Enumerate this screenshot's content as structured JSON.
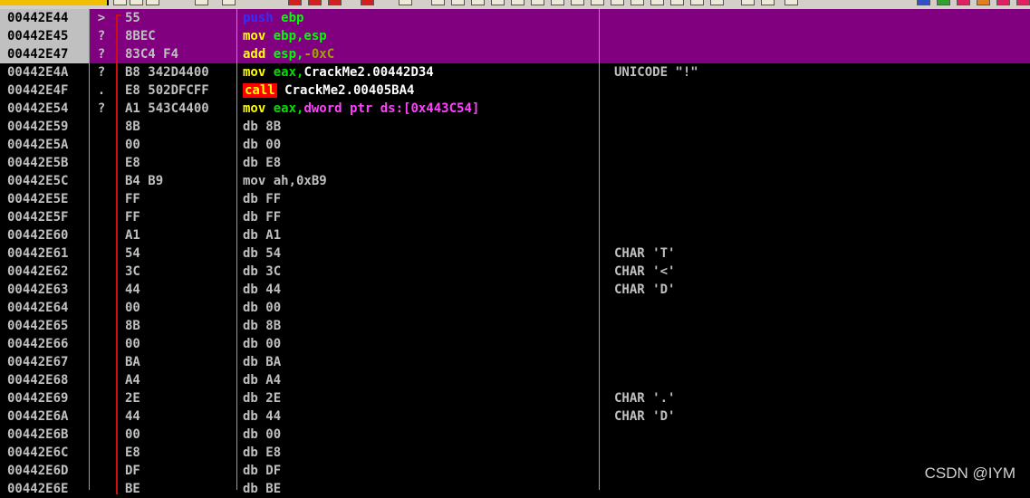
{
  "rows": [
    {
      "addr": "00442E44",
      "mark": ">",
      "hex": "55",
      "asm": [
        {
          "t": "push",
          "c": "c-blue"
        },
        {
          "t": " ebp",
          "c": "c-lime"
        }
      ],
      "cmt": ""
    },
    {
      "addr": "00442E45",
      "mark": "?",
      "hex": "8BEC",
      "asm": [
        {
          "t": "mov ",
          "c": "c-yellow"
        },
        {
          "t": "ebp,esp",
          "c": "c-lime"
        }
      ],
      "cmt": ""
    },
    {
      "addr": "00442E47",
      "mark": "?",
      "hex": "83C4 F4",
      "asm": [
        {
          "t": "add ",
          "c": "c-yellow"
        },
        {
          "t": "esp,",
          "c": "c-lime"
        },
        {
          "t": "-0xC",
          "c": "c-olive"
        }
      ],
      "cmt": ""
    },
    {
      "addr": "00442E4A",
      "mark": "?",
      "hex": "B8 342D4400",
      "asm": [
        {
          "t": "mov ",
          "c": "c-yellow"
        },
        {
          "t": "eax,",
          "c": "c-green"
        },
        {
          "t": "CrackMe2.00442D34",
          "c": "c-white"
        }
      ],
      "cmt": "UNICODE \"!\""
    },
    {
      "addr": "00442E4F",
      "mark": ".",
      "hex": "E8 502DFCFF",
      "asm": [
        {
          "t": "call",
          "c": "call"
        },
        {
          "t": " CrackMe2.00405BA4",
          "c": "c-white"
        }
      ],
      "cmt": ""
    },
    {
      "addr": "00442E54",
      "mark": "?",
      "hex": "A1 543C4400",
      "asm": [
        {
          "t": "mov ",
          "c": "c-yellow"
        },
        {
          "t": "eax,",
          "c": "c-green"
        },
        {
          "t": "dword ptr ds:[0x443C54]",
          "c": "c-magenta"
        }
      ],
      "cmt": ""
    },
    {
      "addr": "00442E59",
      "mark": "",
      "hex": "8B",
      "asm": [
        {
          "t": "db 8B",
          "c": "c-gray"
        }
      ],
      "cmt": ""
    },
    {
      "addr": "00442E5A",
      "mark": "",
      "hex": "00",
      "asm": [
        {
          "t": "db 00",
          "c": "c-gray"
        }
      ],
      "cmt": ""
    },
    {
      "addr": "00442E5B",
      "mark": "",
      "hex": "E8",
      "asm": [
        {
          "t": "db E8",
          "c": "c-gray"
        }
      ],
      "cmt": ""
    },
    {
      "addr": "00442E5C",
      "mark": "",
      "hex": "B4 B9",
      "asm": [
        {
          "t": "mov ah,0xB9",
          "c": "c-gray"
        }
      ],
      "cmt": ""
    },
    {
      "addr": "00442E5E",
      "mark": "",
      "hex": "FF",
      "asm": [
        {
          "t": "db FF",
          "c": "c-gray"
        }
      ],
      "cmt": ""
    },
    {
      "addr": "00442E5F",
      "mark": "",
      "hex": "FF",
      "asm": [
        {
          "t": "db FF",
          "c": "c-gray"
        }
      ],
      "cmt": ""
    },
    {
      "addr": "00442E60",
      "mark": "",
      "hex": "A1",
      "asm": [
        {
          "t": "db A1",
          "c": "c-gray"
        }
      ],
      "cmt": ""
    },
    {
      "addr": "00442E61",
      "mark": "",
      "hex": "54",
      "asm": [
        {
          "t": "db 54",
          "c": "c-gray"
        }
      ],
      "cmt": "CHAR 'T'"
    },
    {
      "addr": "00442E62",
      "mark": "",
      "hex": "3C",
      "asm": [
        {
          "t": "db 3C",
          "c": "c-gray"
        }
      ],
      "cmt": "CHAR '<'"
    },
    {
      "addr": "00442E63",
      "mark": "",
      "hex": "44",
      "asm": [
        {
          "t": "db 44",
          "c": "c-gray"
        }
      ],
      "cmt": "CHAR 'D'"
    },
    {
      "addr": "00442E64",
      "mark": "",
      "hex": "00",
      "asm": [
        {
          "t": "db 00",
          "c": "c-gray"
        }
      ],
      "cmt": ""
    },
    {
      "addr": "00442E65",
      "mark": "",
      "hex": "8B",
      "asm": [
        {
          "t": "db 8B",
          "c": "c-gray"
        }
      ],
      "cmt": ""
    },
    {
      "addr": "00442E66",
      "mark": "",
      "hex": "00",
      "asm": [
        {
          "t": "db 00",
          "c": "c-gray"
        }
      ],
      "cmt": ""
    },
    {
      "addr": "00442E67",
      "mark": "",
      "hex": "BA",
      "asm": [
        {
          "t": "db BA",
          "c": "c-gray"
        }
      ],
      "cmt": ""
    },
    {
      "addr": "00442E68",
      "mark": "",
      "hex": "A4",
      "asm": [
        {
          "t": "db A4",
          "c": "c-gray"
        }
      ],
      "cmt": ""
    },
    {
      "addr": "00442E69",
      "mark": "",
      "hex": "2E",
      "asm": [
        {
          "t": "db 2E",
          "c": "c-gray"
        }
      ],
      "cmt": "CHAR '.'"
    },
    {
      "addr": "00442E6A",
      "mark": "",
      "hex": "44",
      "asm": [
        {
          "t": "db 44",
          "c": "c-gray"
        }
      ],
      "cmt": "CHAR 'D'"
    },
    {
      "addr": "00442E6B",
      "mark": "",
      "hex": "00",
      "asm": [
        {
          "t": "db 00",
          "c": "c-gray"
        }
      ],
      "cmt": ""
    },
    {
      "addr": "00442E6C",
      "mark": "",
      "hex": "E8",
      "asm": [
        {
          "t": "db E8",
          "c": "c-gray"
        }
      ],
      "cmt": ""
    },
    {
      "addr": "00442E6D",
      "mark": "",
      "hex": "DF",
      "asm": [
        {
          "t": "db DF",
          "c": "c-gray"
        }
      ],
      "cmt": ""
    },
    {
      "addr": "00442E6E",
      "mark": "",
      "hex": "BE",
      "asm": [
        {
          "t": "db BE",
          "c": "c-gray"
        }
      ],
      "cmt": ""
    }
  ],
  "selected_rows": 3,
  "watermark": "CSDN @IYM",
  "colors": {
    "selection": "#800080",
    "background": "#000000",
    "jump_line": "#d01010",
    "call_highlight": "#ff0000"
  }
}
